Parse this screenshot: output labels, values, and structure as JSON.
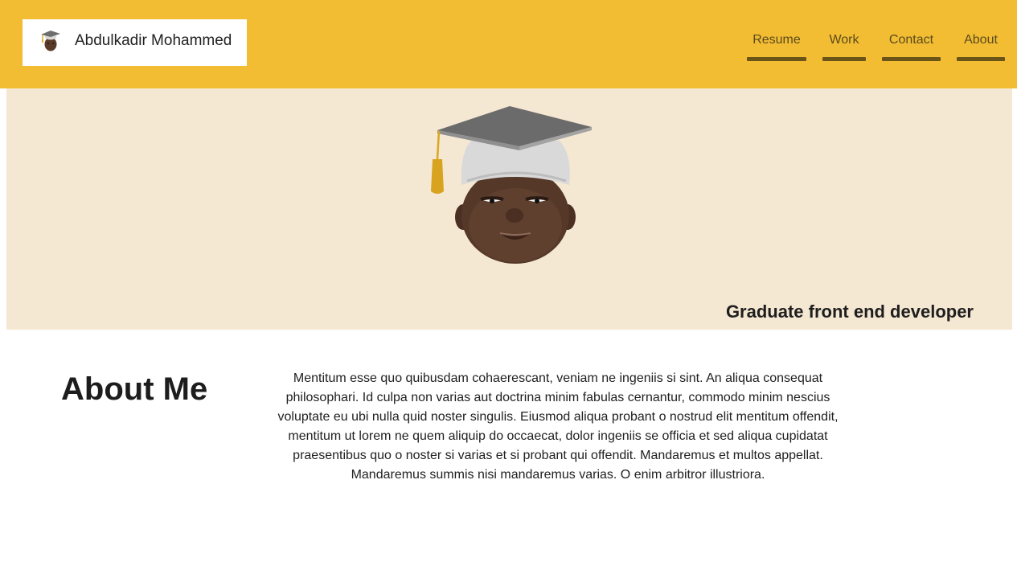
{
  "header": {
    "brand_name": "Abdulkadir Mohammed",
    "logo_icon": "graduate-avatar-icon",
    "nav": [
      {
        "label": "Resume"
      },
      {
        "label": "Work"
      },
      {
        "label": "Contact"
      },
      {
        "label": "About"
      }
    ]
  },
  "hero": {
    "avatar_icon": "graduate-memoji-icon",
    "subtitle": "Graduate front end developer"
  },
  "about": {
    "heading": "About Me",
    "body": "Mentitum esse quo quibusdam cohaerescant, veniam ne ingeniis si sint. An aliqua consequat philosophari. Id culpa non varias aut doctrina minim fabulas cernantur, commodo minim nescius voluptate eu ubi nulla quid noster singulis. Eiusmod aliqua probant o nostrud elit mentitum offendit, mentitum ut lorem ne quem aliquip do occaecat, dolor ingeniis se officia et sed aliqua cupidatat praesentibus quo o noster si varias et si probant qui offendit. Mandaremus et multos appellat. Mandaremus summis nisi mandaremus varias. O enim arbitror illustriora."
  },
  "colors": {
    "header_bg": "#f3bd33",
    "hero_bg": "#f5e8d3",
    "nav_text": "#5a4a1d",
    "nav_underline": "#6b5418"
  }
}
